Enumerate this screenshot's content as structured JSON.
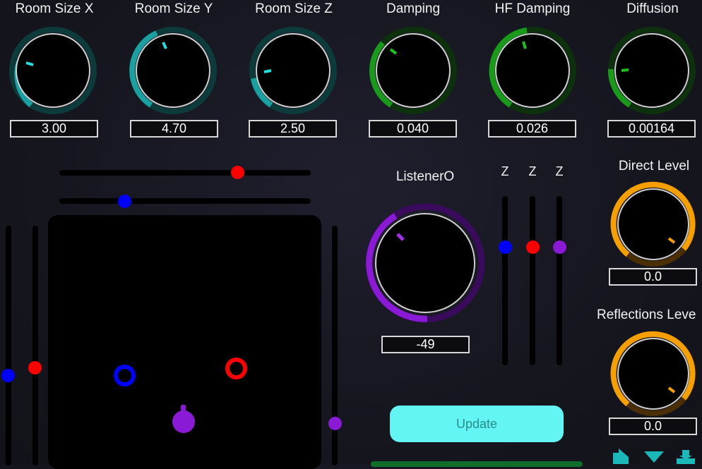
{
  "colors": {
    "teal": "#1aa0a0",
    "green": "#1a9a1a",
    "purple": "#8a1ad6",
    "orange": "#f5a000",
    "red": "#ff0000",
    "blue": "#0000ff",
    "update_button": "#63f4f4"
  },
  "knobs": [
    {
      "label": "Room Size X",
      "value": "3.00"
    },
    {
      "label": "Room Size Y",
      "value": "4.70"
    },
    {
      "label": "Room Size Z",
      "value": "2.50"
    },
    {
      "label": "Damping",
      "value": "0.040"
    },
    {
      "label": "HF Damping",
      "value": "0.026"
    },
    {
      "label": "Diffusion",
      "value": "0.00164"
    }
  ],
  "listener": {
    "label": "ListenerO",
    "value": "-49"
  },
  "z_sliders": {
    "labels": [
      "Z",
      "Z",
      "Z"
    ]
  },
  "direct_level": {
    "label": "Direct Level",
    "value": "0.0"
  },
  "reflections_level": {
    "label": "Reflections Leve",
    "value": "0.0"
  },
  "update_button": {
    "label": "Update"
  }
}
